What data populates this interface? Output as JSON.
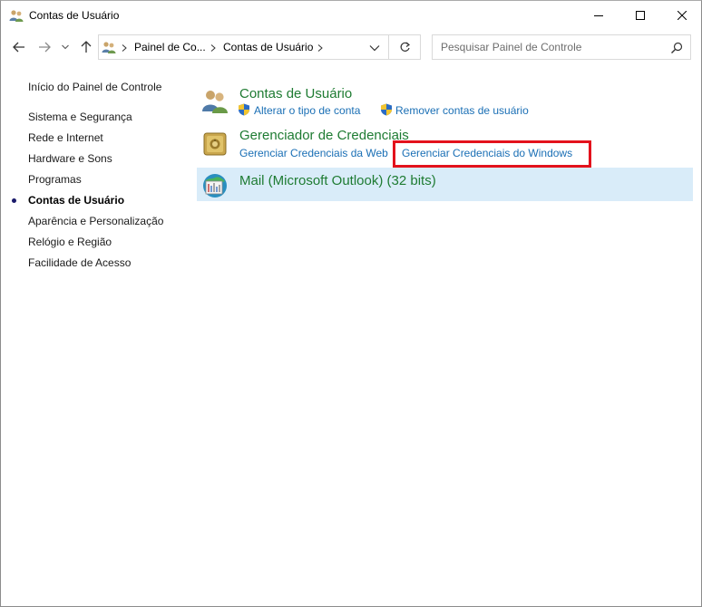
{
  "window": {
    "title": "Contas de Usuário",
    "controls": [
      "minimize",
      "maximize",
      "close"
    ]
  },
  "address_bar": {
    "icon": "user-accounts-icon",
    "breadcrumbs": [
      "Painel de Co...",
      "Contas de Usuário"
    ],
    "search_placeholder": "Pesquisar Painel de Controle"
  },
  "sidebar": {
    "home": "Início do Painel de Controle",
    "items": [
      {
        "label": "Sistema e Segurança",
        "active": false
      },
      {
        "label": "Rede e Internet",
        "active": false
      },
      {
        "label": "Hardware e Sons",
        "active": false
      },
      {
        "label": "Programas",
        "active": false
      },
      {
        "label": "Contas de Usuário",
        "active": true
      },
      {
        "label": "Aparência e Personalização",
        "active": false
      },
      {
        "label": "Relógio e Região",
        "active": false
      },
      {
        "label": "Facilidade de Acesso",
        "active": false
      }
    ]
  },
  "main": {
    "categories": [
      {
        "title": "Contas de Usuário",
        "icon": "user-accounts-icon",
        "tasks": [
          {
            "label": "Alterar o tipo de conta",
            "shield": true
          },
          {
            "label": "Remover contas de usuário",
            "shield": true
          }
        ]
      },
      {
        "title": "Gerenciador de Credenciais",
        "icon": "credential-vault-icon",
        "tasks": [
          {
            "label": "Gerenciar Credenciais da Web",
            "shield": false
          },
          {
            "label": "Gerenciar Credenciais do Windows",
            "shield": false,
            "highlighted": true
          }
        ]
      },
      {
        "title": "Mail (Microsoft Outlook) (32 bits)",
        "icon": "mail-icon",
        "tasks": []
      }
    ]
  },
  "colors": {
    "category_title": "#1e7b32",
    "link": "#1a6fb5",
    "highlight_border": "#e3121c",
    "hover_background": "#d9ecf9"
  }
}
